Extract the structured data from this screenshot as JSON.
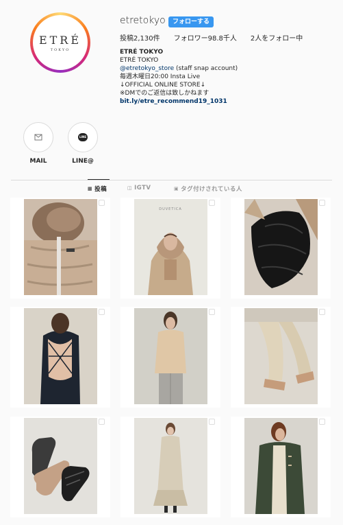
{
  "profile": {
    "username": "etretokyo",
    "follow_label": "フォローする",
    "logo_main": "ETRÉ",
    "logo_sub": "TOKYO",
    "stats": {
      "posts": "投稿2,130件",
      "followers": "フォロワー98.8千人",
      "following": "2人をフォロー中"
    },
    "bio": {
      "name": "ETRÉ TOKYO",
      "line1": "ETRÉ TOKYO",
      "mention": "@etretokyo_store",
      "mention_suffix": " (staff snap account)",
      "line3": "毎週木曜日20:00 Insta Live",
      "line4": "↓OFFICIAL ONLINE STORE↓",
      "line5": "※DMでのご返信は致しかねます",
      "link": "bit.ly/etre_recommend19_1031"
    }
  },
  "highlights": [
    {
      "label": "MAIL",
      "icon": "mail-icon"
    },
    {
      "label": "LINE@",
      "icon": "line-icon",
      "badge": "LINE"
    }
  ],
  "tabs": [
    {
      "label": "投稿",
      "icon": "grid-icon",
      "active": true
    },
    {
      "label": "IGTV",
      "icon": "tv-icon",
      "active": false
    },
    {
      "label": "タグ付けされている人",
      "icon": "tag-icon",
      "active": false
    }
  ],
  "posts": [
    {
      "subject": "beige puffer coat with fur hood"
    },
    {
      "subject": "model in beige hooded jacket",
      "caption": "DUVETICA"
    },
    {
      "subject": "black quilted puffer"
    },
    {
      "subject": "backless navy top"
    },
    {
      "subject": "beige cardigan and grey trousers"
    },
    {
      "subject": "cable knit leggings and flats"
    },
    {
      "subject": "ballet flat shoes"
    },
    {
      "subject": "beige knit dress"
    },
    {
      "subject": "green toggle coat"
    }
  ],
  "colors": {
    "accent": "#3897f0",
    "text": "#262626",
    "link": "#003569",
    "background": "#fafafa"
  }
}
